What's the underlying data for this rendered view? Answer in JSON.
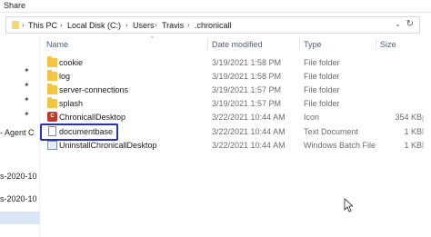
{
  "ribbon": {
    "tab_label": "Share"
  },
  "address": {
    "crumbs": [
      "This PC",
      "Local Disk (C:)",
      "Users",
      "Travis",
      ".chronicall"
    ]
  },
  "nav": {
    "items": [
      {
        "label": "- Agent C",
        "pinned": false
      },
      {
        "label": "s-2020-10",
        "pinned": false
      },
      {
        "label": "s-2020-10",
        "pinned": false
      }
    ]
  },
  "columns": {
    "name": "Name",
    "date": "Date modified",
    "type": "Type",
    "size": "Size"
  },
  "files": [
    {
      "name": "cookie",
      "date": "3/19/2021 1:58 PM",
      "type": "File folder",
      "size": "",
      "icon": "folder-icon"
    },
    {
      "name": "log",
      "date": "3/19/2021 1:58 PM",
      "type": "File folder",
      "size": "",
      "icon": "folder-icon"
    },
    {
      "name": "server-connections",
      "date": "3/19/2021 1:57 PM",
      "type": "File folder",
      "size": "",
      "icon": "folder-icon"
    },
    {
      "name": "splash",
      "date": "3/19/2021 1:57 PM",
      "type": "File folder",
      "size": "",
      "icon": "folder-icon"
    },
    {
      "name": "ChronicallDesktop",
      "date": "3/22/2021 10:44 AM",
      "type": "Icon",
      "size": "354 KB",
      "icon": "app-icon"
    },
    {
      "name": "documentbase",
      "date": "3/22/2021 10:44 AM",
      "type": "Text Document",
      "size": "1 KB",
      "icon": "text-file-icon"
    },
    {
      "name": "UninstallChronicallDesktop",
      "date": "3/22/2021 10:44 AM",
      "type": "Windows Batch File",
      "size": "1 KB",
      "icon": "batch-file-icon"
    }
  ],
  "colors": {
    "highlight": "#2633b8",
    "header_text": "#4d6082",
    "folder": "#f4c542"
  }
}
